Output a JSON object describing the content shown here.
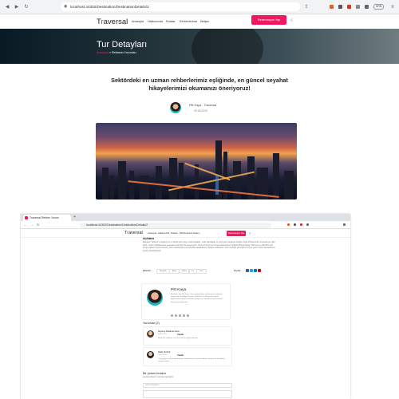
{
  "browser1": {
    "url": "localhost:44302/Destination/DestinationDetails/2",
    "vpn_badge": "VPN"
  },
  "site": {
    "logo_part1": "T",
    "logo_accent": "r",
    "logo_part2": "aversal",
    "menu": [
      "Anasayfa",
      "Hakkımızda",
      "Rotalar",
      "Rehberlerimiz",
      "İletişim"
    ],
    "cta": "Rezervasyon Yap"
  },
  "hero": {
    "title": "Tur Detayları",
    "crumb_home": "Anasayfa",
    "crumb_sep": "»",
    "crumb_current": "Rehberin Yorumları"
  },
  "article": {
    "headline": "Sektördeki en uzman rehberlerimiz eşliğinde, en güncel seyahat hikayelerimizi okumanızı öneriyoruz!",
    "author_line": "Pitt Kaya - Traversal",
    "date": "09.06.2025"
  },
  "browser2": {
    "tab_title": "Traversal Rehber Yorum",
    "url": "localhost:44302/Destination/DestinationDetails/2",
    "cta": "Rezervasyon Yap"
  },
  "content2": {
    "heading": "Açıklama",
    "paragraph": "Bangkok, Tayland'ın başkenti ve en büyük şehri olup, renkli sokakları, tarihi tapınakları ve canlı gece hayatıyla ünlüdür. Chao Phraya Nehri kıyısında yer alan şehir, modern gökdelenlerle geleneksel mimariyi bir araya getirir. Turumuz boyunca uzman rehberlerimiz eşliğinde Büyük Saray, Wat Arun ve Wat Pho gibi simge yapıları ziyaret edecek, yüzen pazarlarda yerel lezzetleri tadacaksınız. Akşam saatlerinde nehir üzerinde gün batımı turu ile şehrin ışıltılı manzarasının keyfini çıkarabilirsiniz.",
    "tags_label": "Etiketler :",
    "tags": [
      "Bangkok",
      "Asya",
      "Kültür",
      "Tur",
      "Gezi"
    ],
    "share_label": "Paylaş :"
  },
  "author_card": {
    "name": "Pitt Kaya",
    "bio": "Merhaba, ben Pitt Kaya. Uzun yıllardır Asya ve Avrupa'da rehberlik yapıyorum. Gezdiğim her yerin kültürünü ve hikayesini sizlerle paylaşmaktan büyük mutluluk duyuyorum. Sorularınız için benimle iletişime geçebilirsiniz."
  },
  "comments": {
    "title": "Yorumlar (2)",
    "items": [
      {
        "name": "Zeynep Melanie Kara",
        "date": "09.06.2025",
        "reply": "Yanıtla",
        "text": "Harika bir rehberdi, tur çok keyifli ve bilgilendiriciydi."
      },
      {
        "name": "Selin Öztürk",
        "date": "09.06.2025",
        "reply": "Yanıtla",
        "text": "Tur programı çok iyi planlanmıştı, rehberimiz her soruya sabırla cevap verdi. Kesinlikle tavsiye ederim."
      }
    ]
  },
  "leave_comment": {
    "title": "Bir yorum bırakın",
    "subtitle": "E-posta adresiniz yayınlanmayacaktır.",
    "name_placeholder": "Adınız Soyadınız"
  },
  "colors": {
    "accent": "#f0185f"
  }
}
